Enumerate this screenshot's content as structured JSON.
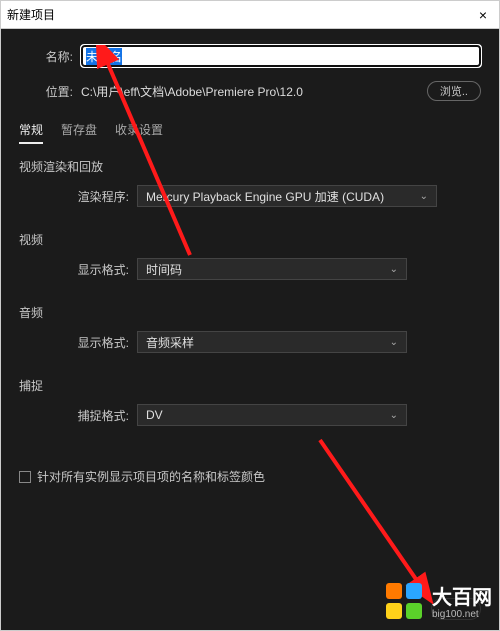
{
  "titlebar": {
    "title": "新建项目",
    "close": "×"
  },
  "name": {
    "label": "名称:",
    "value": "未命名"
  },
  "location": {
    "label": "位置:",
    "path": "C:\\用户\\eff\\文档\\Adobe\\Premiere Pro\\12.0",
    "browse": "浏览.."
  },
  "tabs": {
    "general": "常规",
    "scratch": "暂存盘",
    "ingest": "收录设置"
  },
  "sections": {
    "render": {
      "title": "视频渲染和回放",
      "renderer_label": "渲染程序:",
      "renderer_value": "Mercury Playback Engine GPU 加速 (CUDA)"
    },
    "video": {
      "title": "视频",
      "format_label": "显示格式:",
      "format_value": "时间码"
    },
    "audio": {
      "title": "音频",
      "format_label": "显示格式:",
      "format_value": "音频采样"
    },
    "capture": {
      "title": "捕捉",
      "format_label": "捕捉格式:",
      "format_value": "DV"
    }
  },
  "checkbox": {
    "label": "针对所有实例显示项目项的名称和标签颜色"
  },
  "watermark": {
    "big": "大百网",
    "small": "big100.net"
  }
}
